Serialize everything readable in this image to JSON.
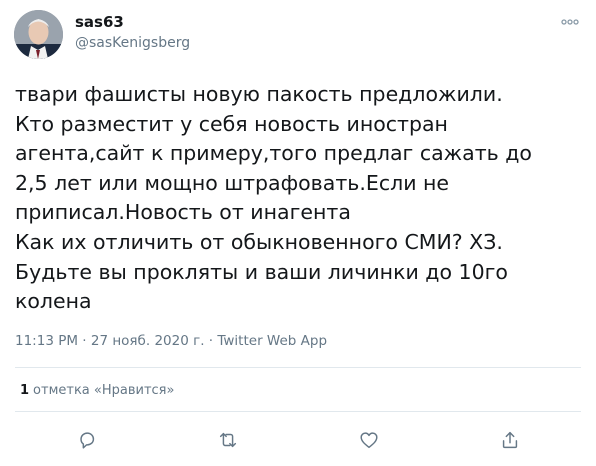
{
  "author": {
    "display_name": "sas63",
    "handle": "@sasKenigsberg",
    "avatar_icon": "user-avatar-photo"
  },
  "tweet": {
    "lines": [
      "твари фашисты новую пакость предложили.",
      "Кто разместит у себя новость иностран",
      "агента,сайт к примеру,того предлаг сажать до",
      "2,5 лет или мощно штрафовать.Если не",
      "приписал.Новость от инагента",
      "Как их отличить от обыкновенного СМИ? ХЗ.",
      "Будьте вы прокляты и ваши личинки до 10го",
      "колена"
    ]
  },
  "meta": {
    "time": "11:13 PM",
    "separator": " · ",
    "date": "27 нояб. 2020 г.",
    "source": "Twitter Web App"
  },
  "engagement": {
    "likes_count": "1",
    "likes_label": "отметка «Нравится»"
  },
  "actions": [
    {
      "name": "reply",
      "icon": "reply-icon"
    },
    {
      "name": "retweet",
      "icon": "retweet-icon"
    },
    {
      "name": "like",
      "icon": "heart-icon"
    },
    {
      "name": "share",
      "icon": "share-icon"
    }
  ],
  "colors": {
    "text_primary": "#14171a",
    "text_secondary": "#657786",
    "divider": "#e1e8ed"
  }
}
